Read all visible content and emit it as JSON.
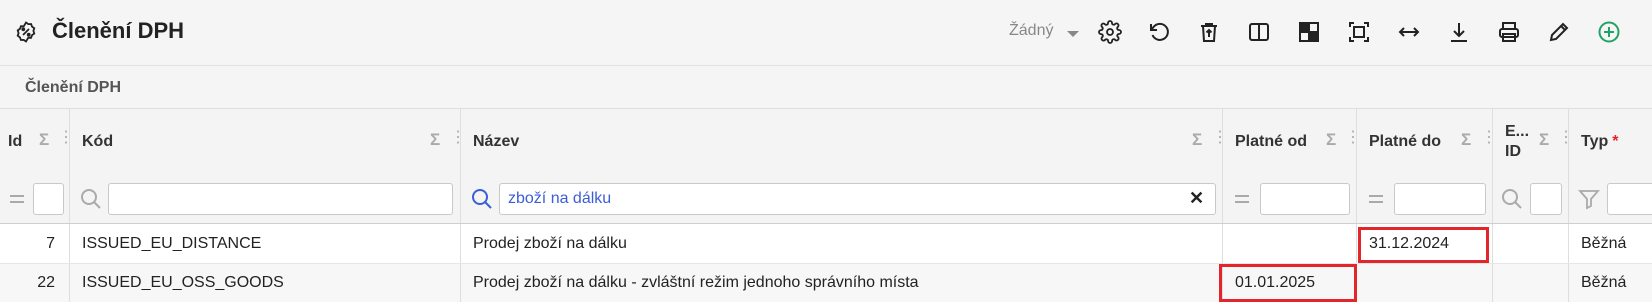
{
  "header": {
    "title": "Členění DPH",
    "variant": "Žádný"
  },
  "toolbar": {
    "icons": [
      "settings-icon",
      "undo-icon",
      "delete-icon",
      "split-view-icon",
      "layout-icon",
      "fit-screen-icon",
      "expand-width-icon",
      "download-icon",
      "print-icon",
      "edit-icon",
      "add-icon"
    ],
    "accent_color": "#21a366"
  },
  "breadcrumb": "Členění DPH",
  "columns": [
    {
      "key": "id",
      "label": "Id"
    },
    {
      "key": "kod",
      "label": "Kód"
    },
    {
      "key": "nazev",
      "label": "Název"
    },
    {
      "key": "platne_od",
      "label": "Platné od"
    },
    {
      "key": "platne_do",
      "label": "Platné do"
    },
    {
      "key": "ext_id",
      "label": "E... ID"
    },
    {
      "key": "typ",
      "label": "Typ"
    }
  ],
  "filters": {
    "nazev": "zboží na dálku",
    "nazev_clear": "✕"
  },
  "rows": [
    {
      "id": "7",
      "kod": "ISSUED_EU_DISTANCE",
      "nazev": "Prodej zboží na dálku",
      "platne_od": "",
      "platne_do": "31.12.2024",
      "ext_id": "",
      "typ": "Běžná"
    },
    {
      "id": "22",
      "kod": "ISSUED_EU_OSS_GOODS",
      "nazev": "Prodej zboží na dálku - zvláštní režim jednoho správního místa",
      "platne_od": "01.01.2025",
      "platne_do": "",
      "ext_id": "",
      "typ": "Běžná"
    }
  ],
  "highlight_color": "#e2262b"
}
